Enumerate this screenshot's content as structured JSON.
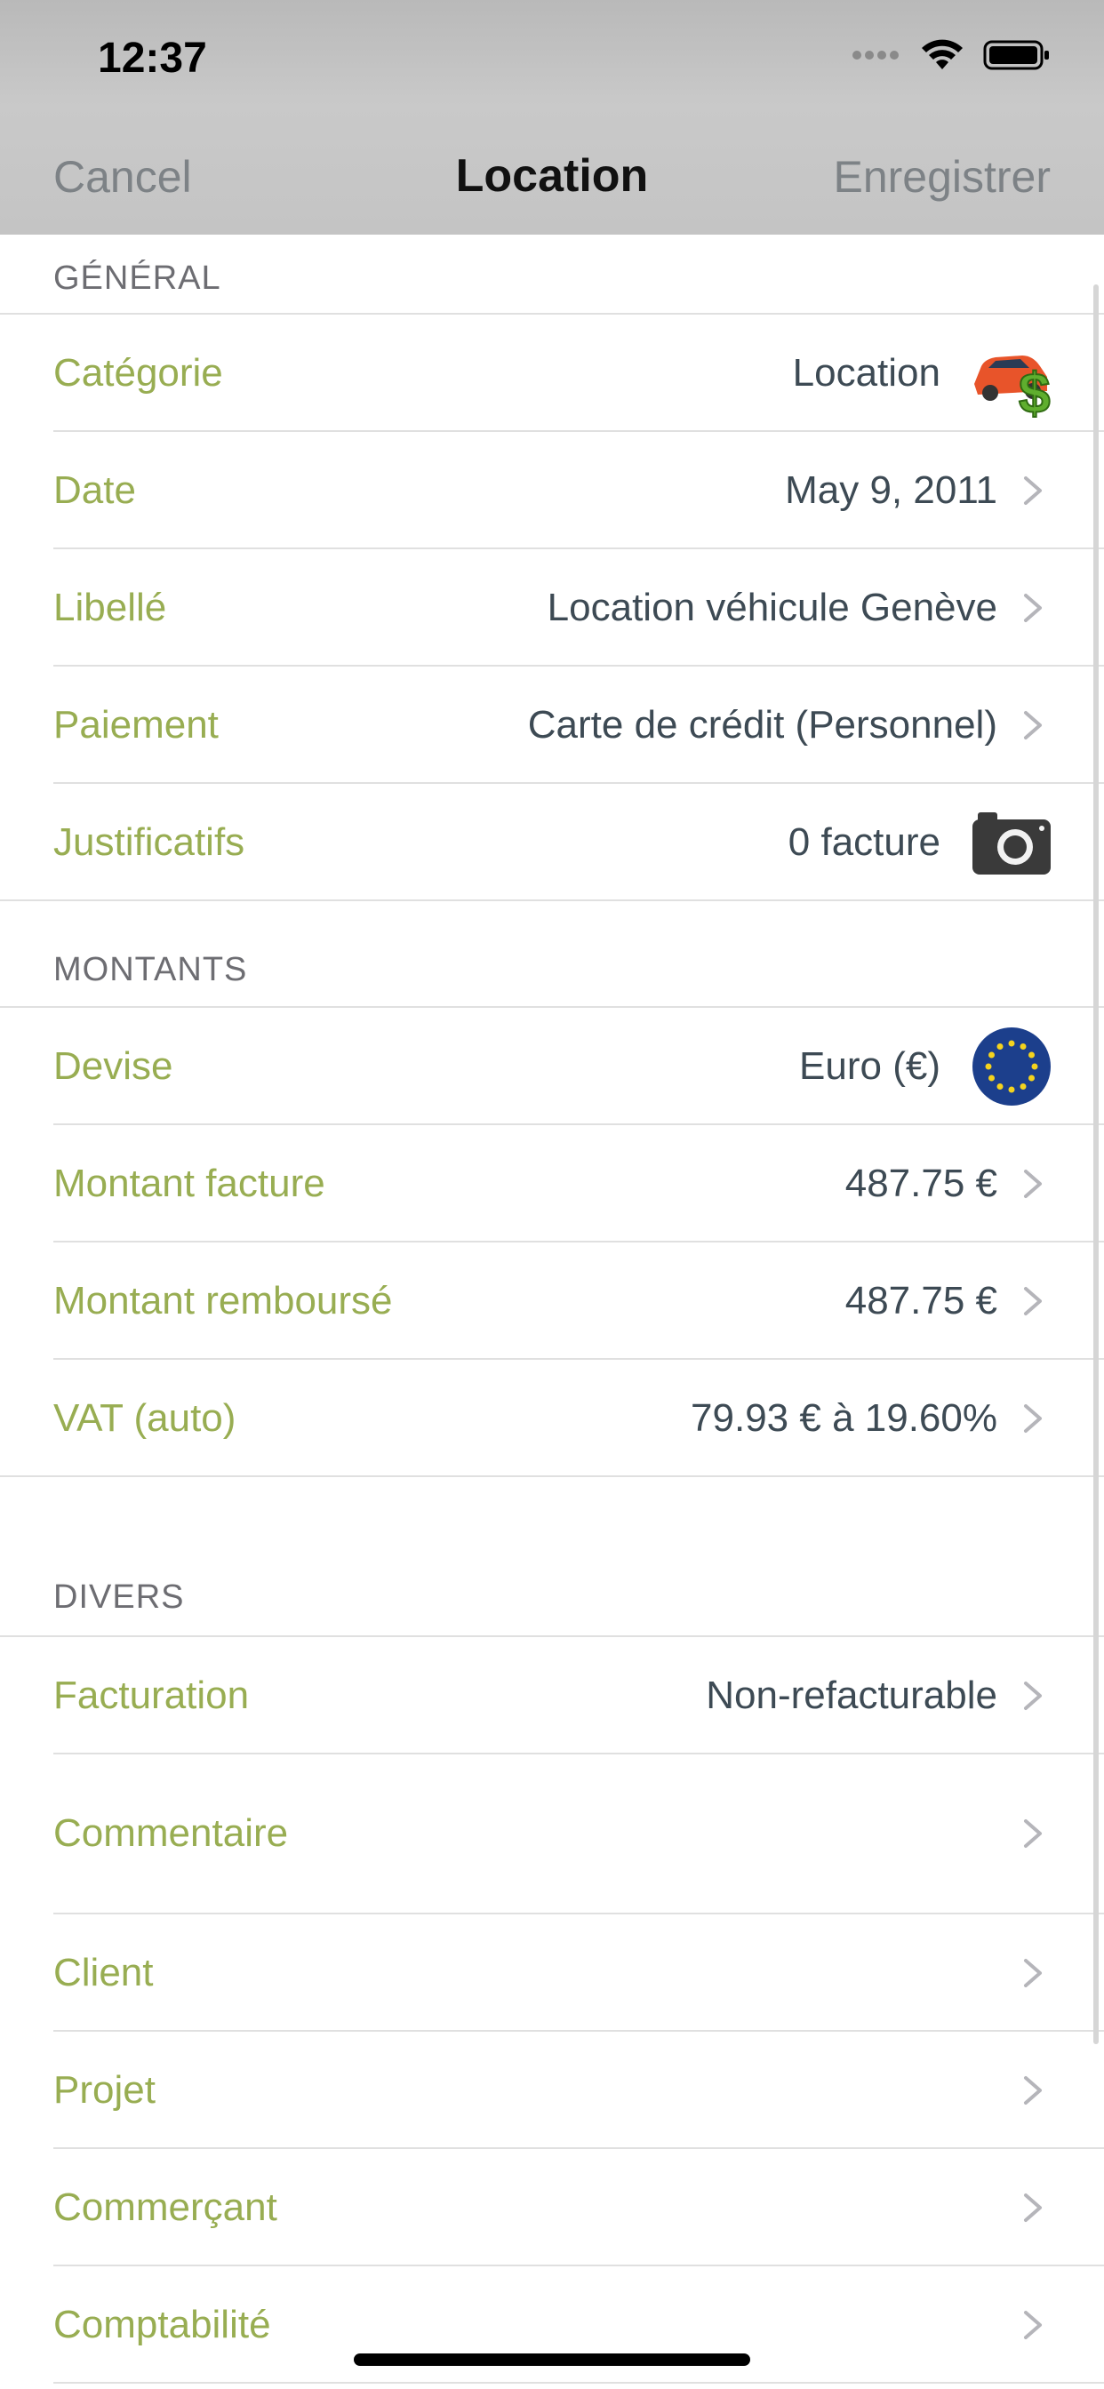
{
  "status_bar": {
    "time": "12:37"
  },
  "nav": {
    "cancel": "Cancel",
    "title": "Location",
    "save": "Enregistrer"
  },
  "sections": {
    "general": {
      "header": "GÉNÉRAL",
      "rows": [
        {
          "label": "Catégorie",
          "value": "Location",
          "icon": "car-money-icon"
        },
        {
          "label": "Date",
          "value": "May 9, 2011"
        },
        {
          "label": "Libellé",
          "value": "Location véhicule Genève"
        },
        {
          "label": "Paiement",
          "value": "Carte de crédit (Personnel)"
        },
        {
          "label": "Justificatifs",
          "value": "0 facture",
          "icon": "camera-icon"
        }
      ]
    },
    "montants": {
      "header": "MONTANTS",
      "rows": [
        {
          "label": "Devise",
          "value": "Euro (€)",
          "icon": "eu-flag-icon"
        },
        {
          "label": "Montant facture",
          "value": "487.75 €"
        },
        {
          "label": "Montant remboursé",
          "value": "487.75 €"
        },
        {
          "label": "VAT (auto)",
          "value": "79.93 € à 19.60%"
        }
      ]
    },
    "divers": {
      "header": "DIVERS",
      "rows": [
        {
          "label": "Facturation",
          "value": "Non-refacturable"
        },
        {
          "label": "Commentaire",
          "value": ""
        },
        {
          "label": "Client",
          "value": ""
        },
        {
          "label": "Projet",
          "value": ""
        },
        {
          "label": "Commerçant",
          "value": ""
        },
        {
          "label": "Comptabilité",
          "value": ""
        }
      ]
    }
  },
  "colors": {
    "label": "#98ad52",
    "value": "#3d4a54",
    "header": "#6d6d72"
  }
}
